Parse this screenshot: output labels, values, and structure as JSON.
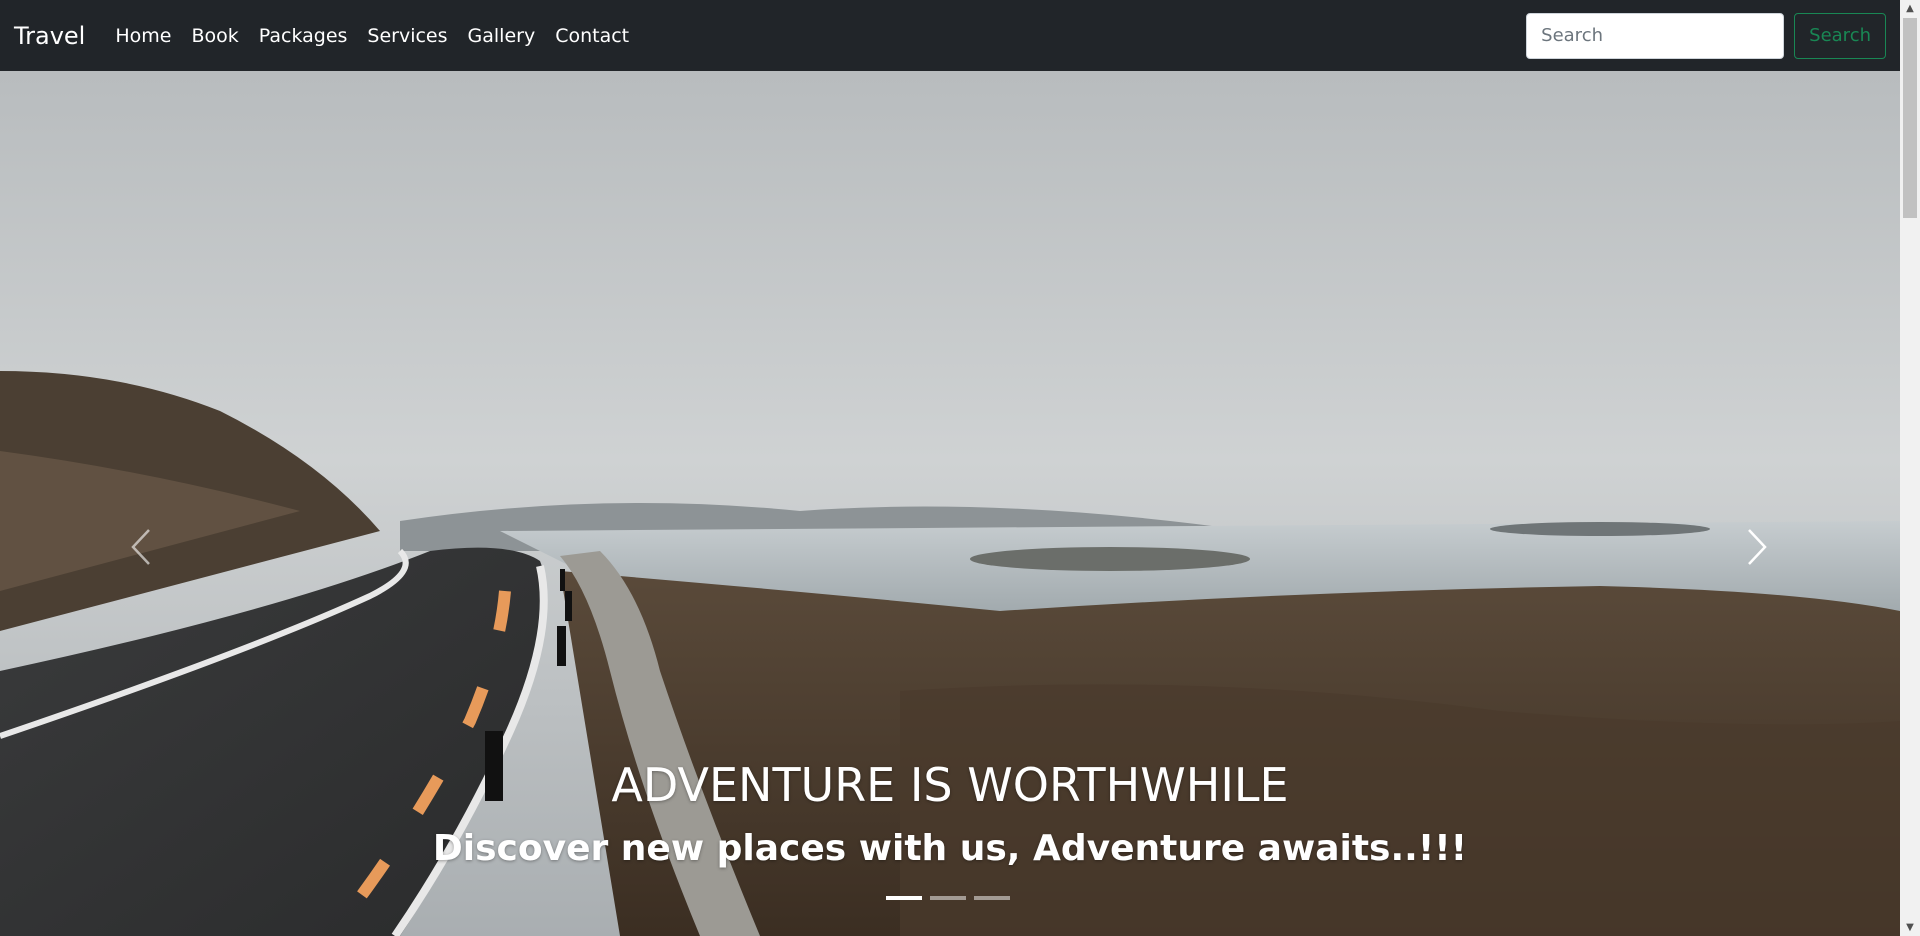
{
  "navbar": {
    "brand": "Travel",
    "links": [
      "Home",
      "Book",
      "Packages",
      "Services",
      "Gallery",
      "Contact"
    ],
    "search": {
      "placeholder": "Search",
      "value": "",
      "button_label": "Search"
    }
  },
  "carousel": {
    "title": "ADVENTURE IS WORTHWHILE",
    "subtitle": "Discover new places with us, Adventure awaits..!!!",
    "slides_count": 3,
    "active_slide": 1,
    "prev_icon": "chevron-left-icon",
    "next_icon": "chevron-right-icon"
  },
  "colors": {
    "navbar_bg": "#212529",
    "search_button": "#198754"
  }
}
